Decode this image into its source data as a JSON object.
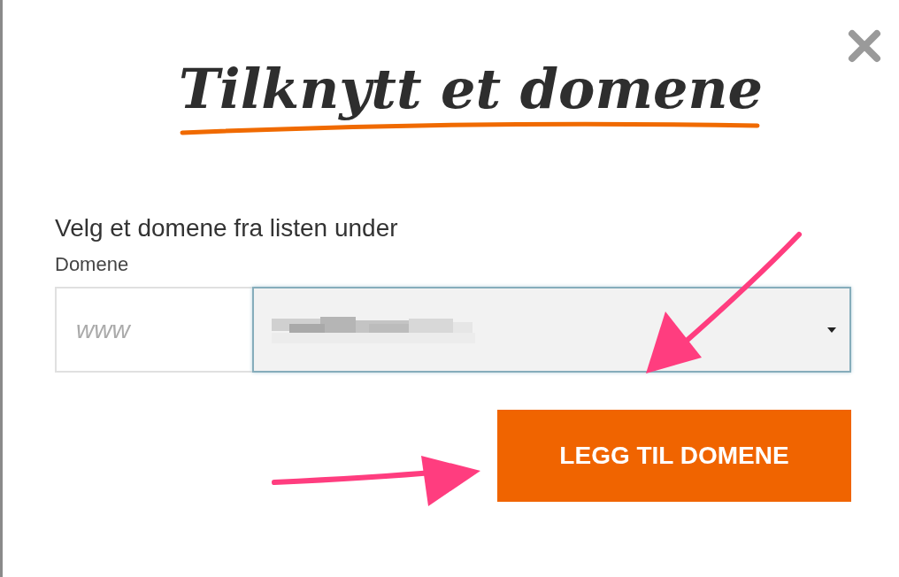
{
  "title": "Tilknytt et domene",
  "prompt": "Velg et domene fra listen under",
  "field_label": "Domene",
  "prefix_field": {
    "placeholder": "www"
  },
  "button": "LEGG TIL DOMENE"
}
